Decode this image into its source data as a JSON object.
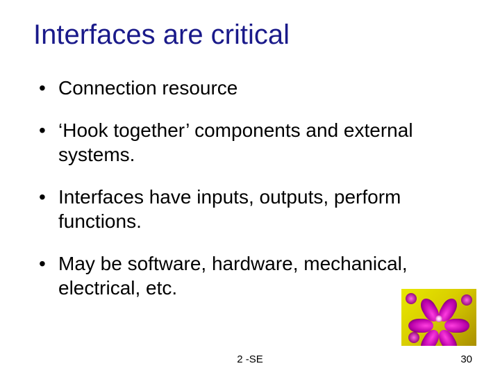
{
  "title": "Interfaces are critical",
  "bullets": [
    "Connection resource",
    "‘Hook together’ components and external systems.",
    "Interfaces have inputs, outputs, perform functions.",
    "May be software, hardware, mechanical, electrical, etc."
  ],
  "footer": {
    "center": "2 -SE",
    "page": "30"
  },
  "image": {
    "alt": "fractal-flower-thumbnail"
  }
}
